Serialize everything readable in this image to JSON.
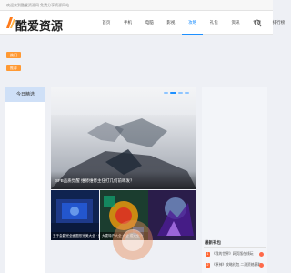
{
  "topbar": {
    "notice": "欢迎来到酷爱资源网 免费分享资源网站"
  },
  "header": {
    "logo_text": "酷爱资源",
    "nav": [
      {
        "label": "首页"
      },
      {
        "label": "手机"
      },
      {
        "label": "电脑"
      },
      {
        "label": "影视"
      },
      {
        "label": "攻略"
      },
      {
        "label": "礼包"
      },
      {
        "label": "资讯"
      },
      {
        "label": "专题"
      },
      {
        "label": "排行榜"
      }
    ],
    "active_index": 4
  },
  "tags": [
    "热门",
    "推荐"
  ],
  "left_col": {
    "heading": "今日精选"
  },
  "slider": {
    "caption": "SFB品质觉醒 维修维修主任打几何前哨发？",
    "slide_count": 4,
    "active_slide": 1
  },
  "thumbs": [
    {
      "caption": "王于会翻完全面图形完美大全 · 战行"
    },
    {
      "caption": "大麦特产大全 大全 成大全大"
    },
    {
      "caption": ""
    }
  ],
  "ranking": {
    "title": "最新礼包",
    "items": [
      {
        "num": "1",
        "text": "《我的世界》网页版在线玩 "
      },
      {
        "num": "2",
        "text": "《原神》攻略礼包 二测资格获取"
      }
    ]
  },
  "colors": {
    "accent": "#1e90ff",
    "tag": "#ff9933",
    "left_head": "#cfe0f7"
  }
}
